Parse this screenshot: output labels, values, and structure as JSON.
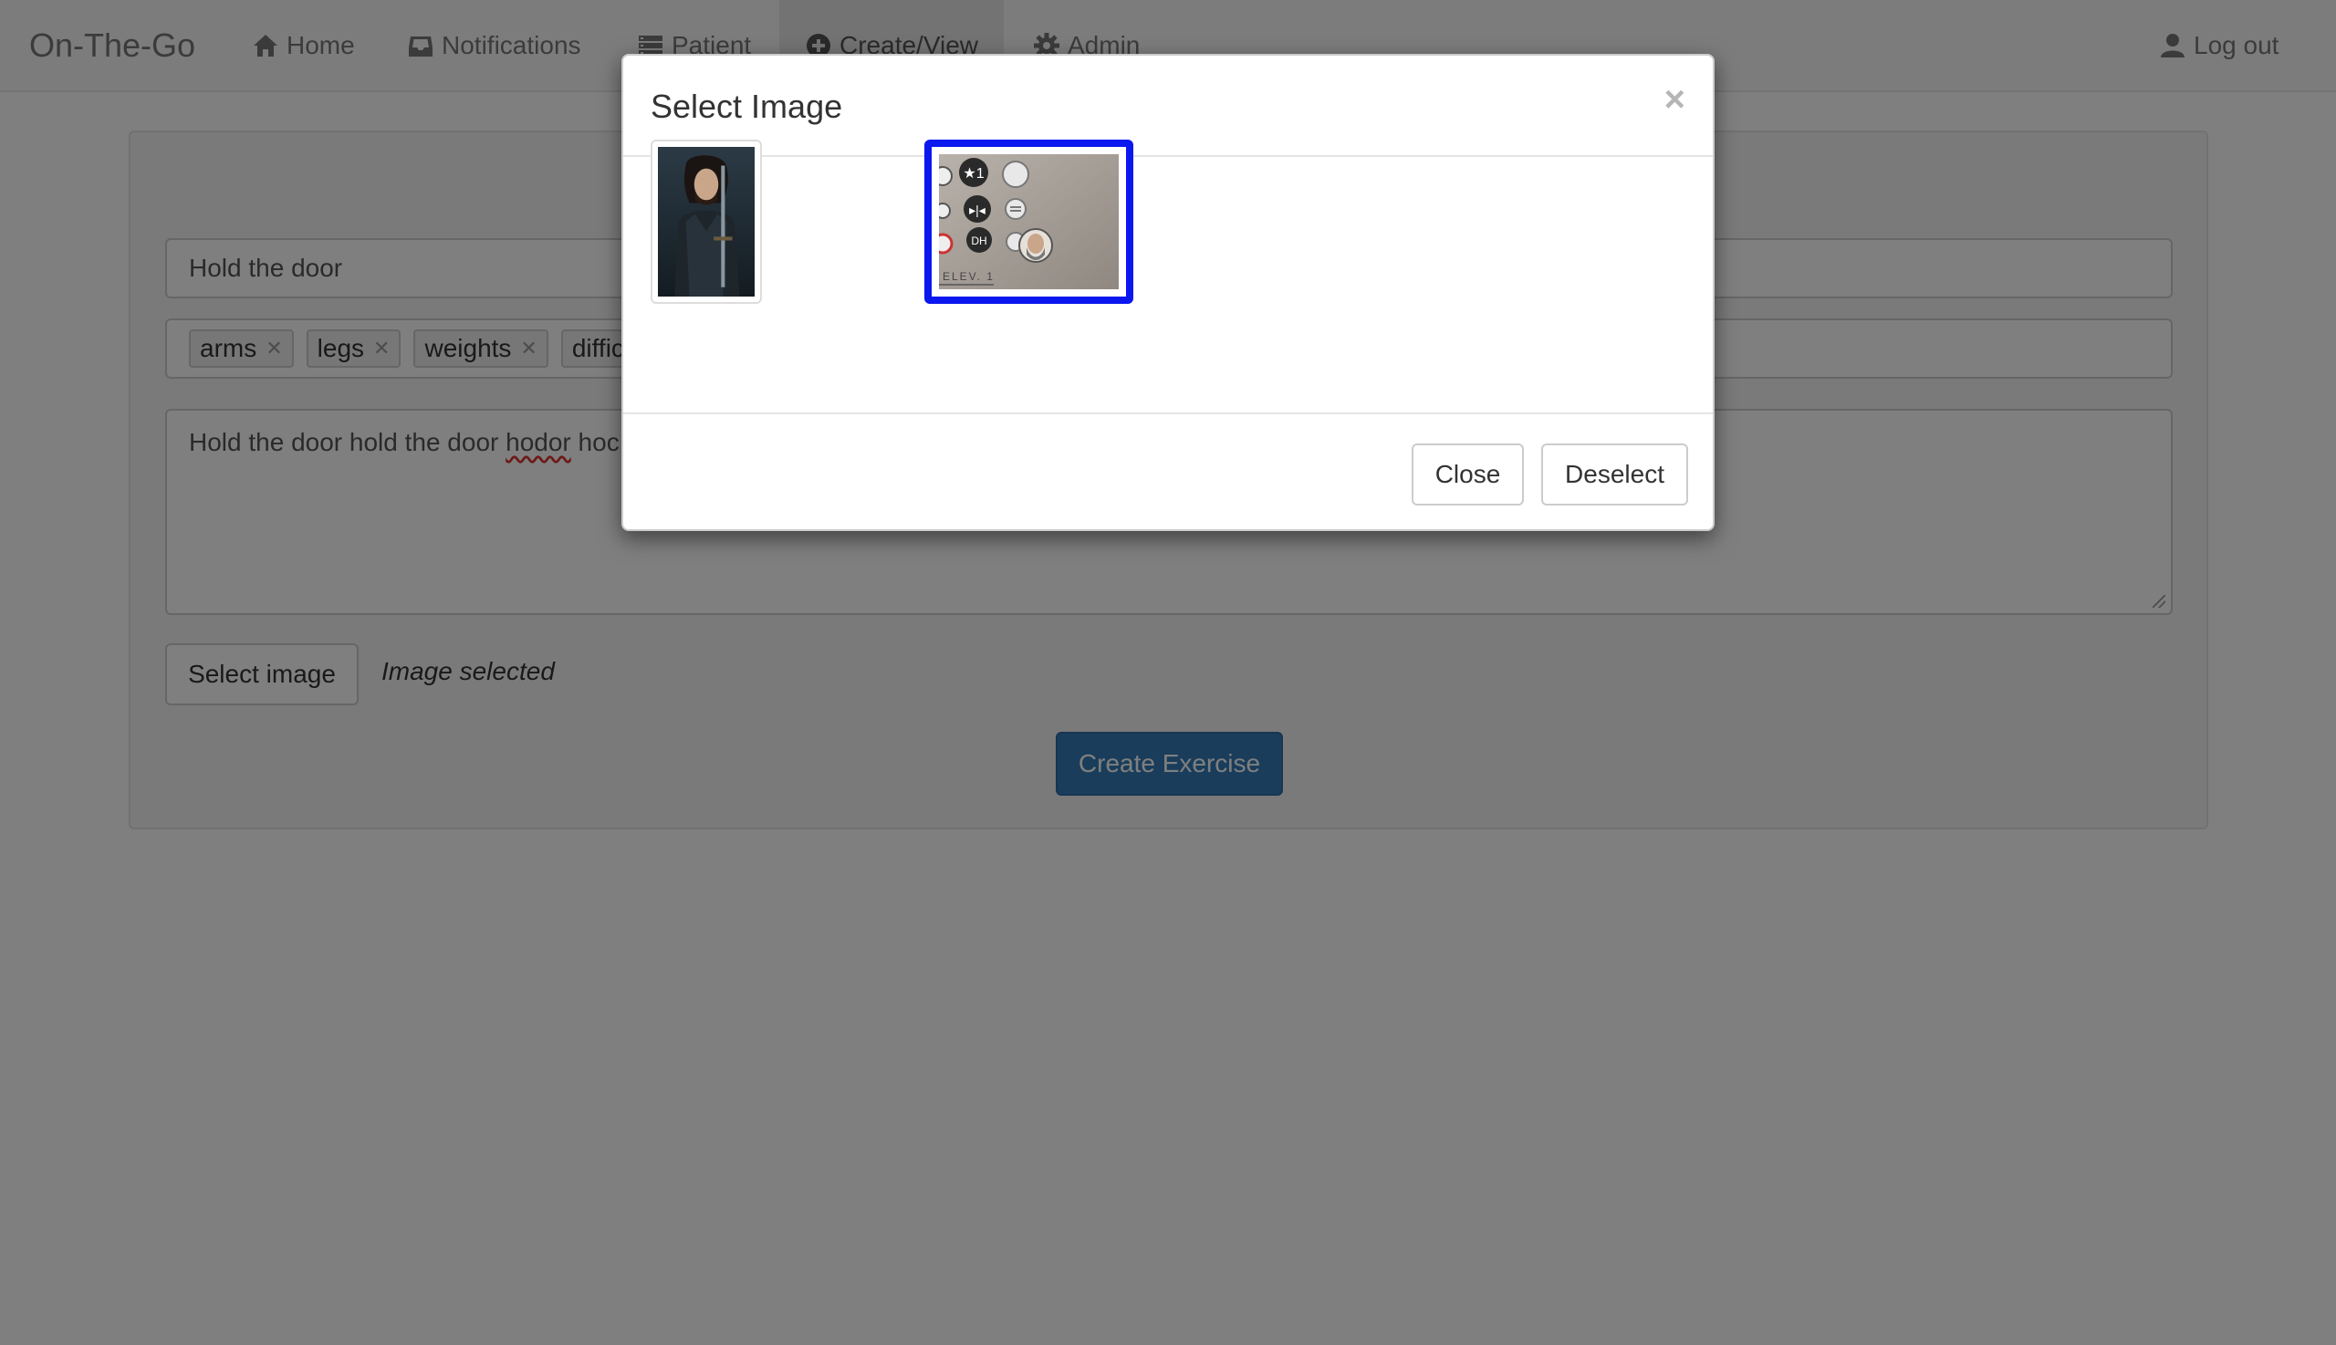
{
  "navbar": {
    "brand": "On-The-Go",
    "items": [
      {
        "label": "Home",
        "icon": "home-icon"
      },
      {
        "label": "Notifications",
        "icon": "inbox-icon"
      },
      {
        "label": "Patient",
        "icon": "list-icon"
      },
      {
        "label": "Create/View",
        "icon": "plus-circle-icon",
        "active": true
      },
      {
        "label": "Admin",
        "icon": "gear-icon"
      }
    ],
    "logout": {
      "label": "Log out",
      "icon": "user-icon"
    }
  },
  "form": {
    "title_value": "Hold the door",
    "tags": [
      "arms",
      "legs",
      "weights",
      "difficul"
    ],
    "description_value_plain": "Hold the door hold the door ",
    "description_value_spell": "hodor",
    "description_value_tail": " hoc",
    "select_image_label": "Select image",
    "image_status": "Image selected",
    "create_label": "Create Exercise"
  },
  "modal": {
    "title": "Select Image",
    "close_symbol": "×",
    "images": [
      {
        "name": "knight-portrait",
        "selected": false
      },
      {
        "name": "elevator-buttons",
        "selected": true
      }
    ],
    "close_label": "Close",
    "deselect_label": "Deselect"
  },
  "colors": {
    "selection_border": "#0a17ee",
    "primary_button": "#337ab7",
    "backdrop": "rgba(0,0,0,0.5)"
  }
}
